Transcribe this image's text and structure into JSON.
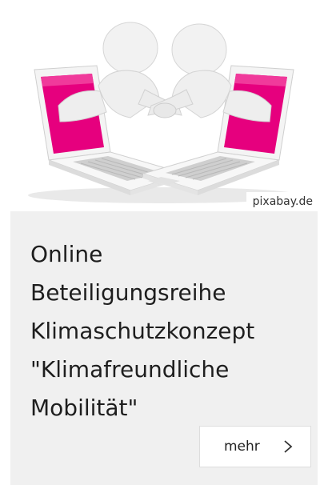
{
  "teaser": {
    "image_icon": "handshake-laptops-illustration",
    "image_credit": "pixabay.de",
    "title_lines": [
      "Online",
      "Beteiligungsreihe",
      "Klimaschutzkonzept",
      "\"Klimafreundliche",
      "Mobilität\""
    ],
    "more_label": "mehr",
    "more_icon": "chevron-right-icon"
  },
  "colors": {
    "card_background": "#f0f0f0",
    "screen_accent": "#e6007e",
    "title_text": "#1e1e1e"
  }
}
